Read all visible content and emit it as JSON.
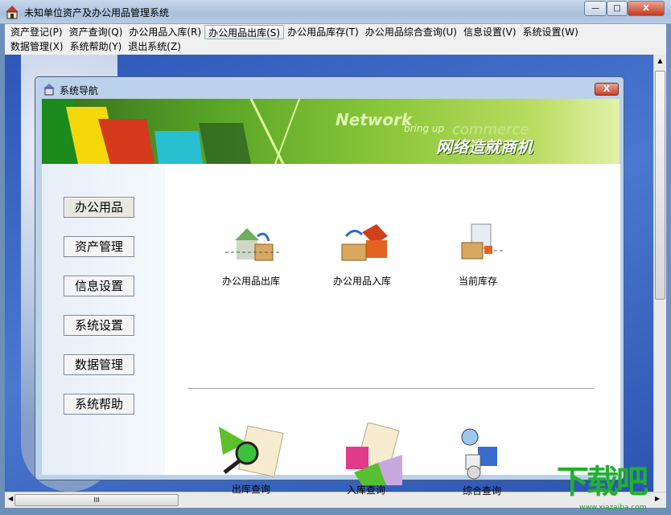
{
  "window": {
    "title": "未知单位资产及办公用品管理系统",
    "min": "—",
    "max": "□",
    "close": "X"
  },
  "menu": {
    "row1": [
      "资产登记(P)",
      "资产查询(Q)",
      "办公用品入库(R)",
      "办公用品出库(S)",
      "办公用品库存(T)",
      "办公用品综合查询(U)",
      "信息设置(V)",
      "系统设置(W)"
    ],
    "row2": [
      "数据管理(X)",
      "系统帮助(Y)",
      "退出系统(Z)"
    ]
  },
  "child": {
    "title": "系统导航",
    "close": "X"
  },
  "banner": {
    "network": "Network",
    "bring_up": "bring up",
    "commerce": "commerce",
    "slogan": "网络造就商机"
  },
  "nav": [
    "办公用品",
    "资产管理",
    "信息设置",
    "系统设置",
    "数据管理",
    "系统帮助"
  ],
  "tiles": {
    "row1": [
      "办公用品出库",
      "办公用品入库",
      "当前库存"
    ],
    "row2": [
      "出库查询",
      "入库查询",
      "综合查询"
    ]
  },
  "scroll": {
    "thumb_grip": "III"
  },
  "watermark": {
    "logo": "下载吧",
    "url": "www.xiazaiba.com"
  }
}
